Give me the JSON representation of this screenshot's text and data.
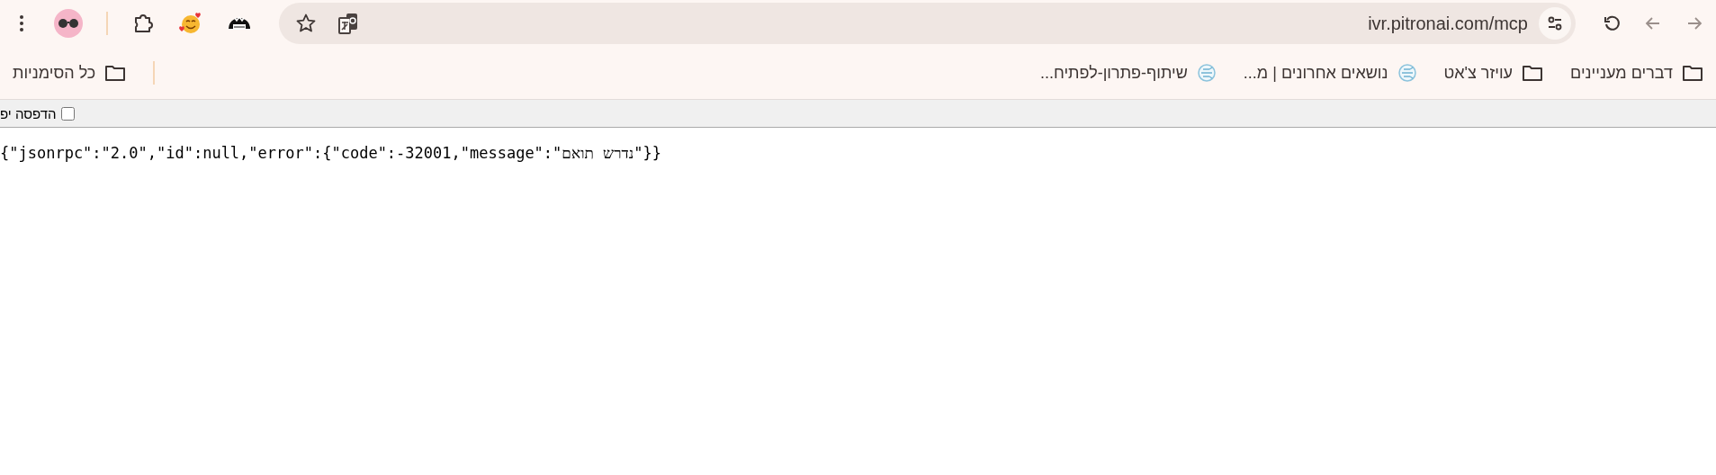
{
  "toolbar": {
    "url": "ivr.pitronai.com/mcp"
  },
  "bookmarks": [
    {
      "kind": "folder",
      "label": "דברים מעניינים"
    },
    {
      "kind": "folder",
      "label": "עויזר צ'אט"
    },
    {
      "kind": "site",
      "label": "נושאים אחרונים | מ..."
    },
    {
      "kind": "site",
      "label": "שיתוף-פתרון-לפתיח..."
    }
  ],
  "all_bookmarks": {
    "label": "כל הסימניות"
  },
  "pretty_print": {
    "label": "הדפסה יפ",
    "checked": false
  },
  "body": "{\"jsonrpc\":\"2.0\",\"id\":null,\"error\":{\"code\":-32001,\"message\":\"נדרש תואם\"}}"
}
